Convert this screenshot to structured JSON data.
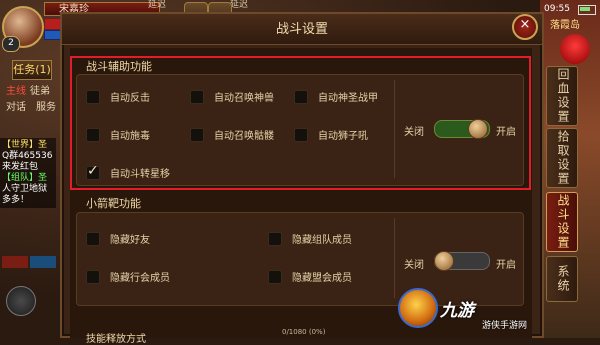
{
  "hud": {
    "player_name": "宋嘉珍",
    "level": "2",
    "task_button": "任务(1)",
    "main_tag": "主线",
    "task_text": "徒弟",
    "dialog_label": "对话",
    "service_label": "服务",
    "top_label_1": "延迟",
    "top_label_2": "延迟",
    "clock": "09:55",
    "map_name": "落霞岛",
    "exp_text": "0/1080 (0%)"
  },
  "chat": {
    "lines": [
      {
        "text": "【世界】圣",
        "color": "#ffe066"
      },
      {
        "text": "Q群465536",
        "color": "#ffffff"
      },
      {
        "text": "来发红包",
        "color": "#ffffff"
      },
      {
        "text": "【组队】圣",
        "color": "#66ff66"
      },
      {
        "text": "人守卫地狱",
        "color": "#ffffff"
      },
      {
        "text": "多多！",
        "color": "#ffffff"
      }
    ]
  },
  "panel": {
    "title": "战斗设置",
    "close_label": "×",
    "section1": {
      "title": "战斗辅助功能",
      "options": [
        {
          "label": "自动反击",
          "checked": false
        },
        {
          "label": "自动召唤神兽",
          "checked": false
        },
        {
          "label": "自动神圣战甲",
          "checked": false
        },
        {
          "label": "自动施毒",
          "checked": false
        },
        {
          "label": "自动召唤骷髅",
          "checked": false
        },
        {
          "label": "自动狮子吼",
          "checked": false
        },
        {
          "label": "自动斗转星移",
          "checked": true
        }
      ],
      "toggle_off": "关闭",
      "toggle_on": "开启"
    },
    "section2": {
      "title": "小箭靶功能",
      "options": [
        {
          "label": "隐藏好友",
          "checked": false
        },
        {
          "label": "隐藏组队成员",
          "checked": false
        },
        {
          "label": "隐藏行会成员",
          "checked": false
        },
        {
          "label": "隐藏盟会成员",
          "checked": false
        }
      ],
      "toggle_off": "关闭",
      "toggle_on": "开启"
    },
    "section3_title": "技能释放方式"
  },
  "tabs": [
    {
      "label": "回血设置",
      "active": false
    },
    {
      "label": "拾取设置",
      "active": false
    },
    {
      "label": "战斗设置",
      "active": true
    },
    {
      "label": "系统",
      "active": false
    }
  ],
  "watermark": {
    "text": "九游",
    "sub": "游侠手游网"
  },
  "colors": {
    "highlight_frame": "#e01e2a",
    "toggle_on": "#2c5a1c",
    "accent_gold": "#c9a455"
  }
}
